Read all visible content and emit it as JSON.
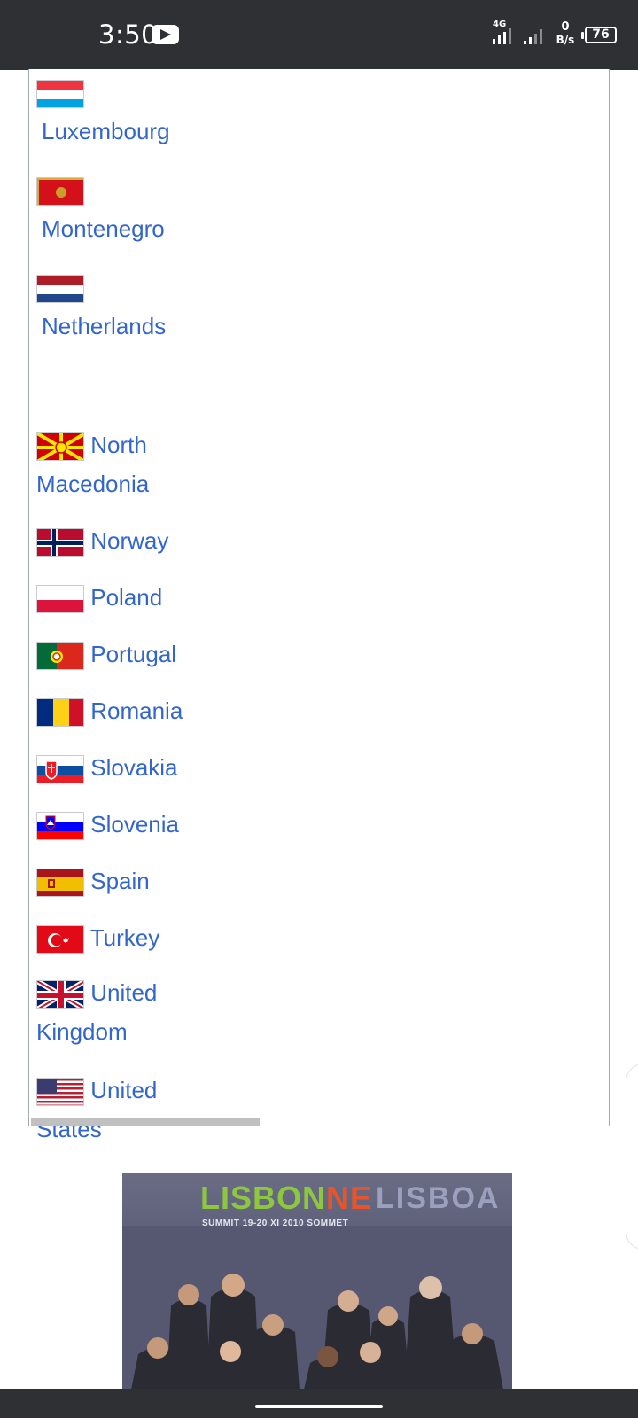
{
  "status_bar": {
    "time": "3:50",
    "network": "4G",
    "speed_value": "0",
    "speed_unit": "B/s",
    "battery": "76",
    "icons": [
      "youtube-icon",
      "signal-icon",
      "signal-icon",
      "battery-icon"
    ]
  },
  "countries": [
    {
      "name": "Luxembourg",
      "flag": "luxembourg-flag"
    },
    {
      "name": "Montenegro",
      "flag": "montenegro-flag"
    },
    {
      "name": "Netherlands",
      "flag": "netherlands-flag"
    },
    {
      "name_line1": "North",
      "name_line2": "Macedonia",
      "flag": "north-macedonia-flag"
    },
    {
      "name": "Norway",
      "flag": "norway-flag"
    },
    {
      "name": "Poland",
      "flag": "poland-flag"
    },
    {
      "name": "Portugal",
      "flag": "portugal-flag"
    },
    {
      "name": "Romania",
      "flag": "romania-flag"
    },
    {
      "name": "Slovakia",
      "flag": "slovakia-flag"
    },
    {
      "name": "Slovenia",
      "flag": "slovenia-flag"
    },
    {
      "name": "Spain",
      "flag": "spain-flag"
    },
    {
      "name": "Turkey",
      "flag": "turkey-flag"
    },
    {
      "name_line1": "United",
      "name_line2": "Kingdom",
      "flag": "uk-flag"
    },
    {
      "name_line1": "United",
      "name_line2": "States",
      "flag": "us-flag"
    }
  ],
  "photo": {
    "banner_text_1a": "LISBON",
    "banner_text_1b": "NE",
    "banner_text_2": "LISBOA",
    "summit_text": "SUMMIT 19-20 XI 2010 SOMMET"
  },
  "colors": {
    "link": "#3366cc",
    "status_bar": "#2f3033"
  }
}
